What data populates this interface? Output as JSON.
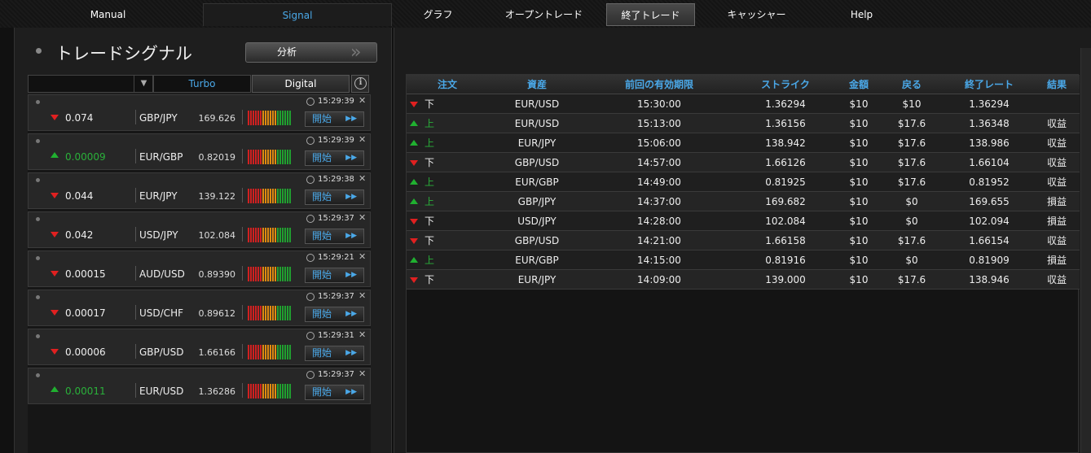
{
  "nav": {
    "tabs": [
      {
        "label": "Manual"
      },
      {
        "label": "Signal"
      },
      {
        "label": "グラフ"
      },
      {
        "label": "オープントレード"
      },
      {
        "label": "終了トレード"
      },
      {
        "label": "キャッシャー"
      },
      {
        "label": "Help"
      }
    ],
    "active_tab": "終了トレード"
  },
  "signal_panel": {
    "title": "トレードシグナル",
    "analyze_button": "分析",
    "filter": {
      "selected": "",
      "turbo_label": "Turbo",
      "digital_label": "Digital"
    },
    "start_label": "開始",
    "signals": [
      {
        "direction": "down",
        "value": "0.074",
        "pair": "GBP/JPY",
        "price": "169.626",
        "time": "15:29:39"
      },
      {
        "direction": "up",
        "value": "0.00009",
        "pair": "EUR/GBP",
        "price": "0.82019",
        "time": "15:29:39"
      },
      {
        "direction": "down",
        "value": "0.044",
        "pair": "EUR/JPY",
        "price": "139.122",
        "time": "15:29:38"
      },
      {
        "direction": "down",
        "value": "0.042",
        "pair": "USD/JPY",
        "price": "102.084",
        "time": "15:29:37"
      },
      {
        "direction": "down",
        "value": "0.00015",
        "pair": "AUD/USD",
        "price": "0.89390",
        "time": "15:29:21"
      },
      {
        "direction": "down",
        "value": "0.00017",
        "pair": "USD/CHF",
        "price": "0.89612",
        "time": "15:29:37"
      },
      {
        "direction": "down",
        "value": "0.00006",
        "pair": "GBP/USD",
        "price": "1.66166",
        "time": "15:29:31"
      },
      {
        "direction": "up",
        "value": "0.00011",
        "pair": "EUR/USD",
        "price": "1.36286",
        "time": "15:29:37"
      }
    ]
  },
  "closed_trades": {
    "columns": [
      "注文",
      "資産",
      "前回の有効期限",
      "ストライク",
      "金額",
      "戻る",
      "終了レート",
      "結果"
    ],
    "rows": [
      {
        "direction": "down",
        "order": "下",
        "asset": "EUR/USD",
        "expiry": "15:30:00",
        "strike": "1.36294",
        "amount": "$10",
        "return": "$10",
        "close_rate": "1.36294",
        "result": ""
      },
      {
        "direction": "up",
        "order": "上",
        "asset": "EUR/USD",
        "expiry": "15:13:00",
        "strike": "1.36156",
        "amount": "$10",
        "return": "$17.6",
        "close_rate": "1.36348",
        "result": "収益"
      },
      {
        "direction": "up",
        "order": "上",
        "asset": "EUR/JPY",
        "expiry": "15:06:00",
        "strike": "138.942",
        "amount": "$10",
        "return": "$17.6",
        "close_rate": "138.986",
        "result": "収益"
      },
      {
        "direction": "down",
        "order": "下",
        "asset": "GBP/USD",
        "expiry": "14:57:00",
        "strike": "1.66126",
        "amount": "$10",
        "return": "$17.6",
        "close_rate": "1.66104",
        "result": "収益"
      },
      {
        "direction": "up",
        "order": "上",
        "asset": "EUR/GBP",
        "expiry": "14:49:00",
        "strike": "0.81925",
        "amount": "$10",
        "return": "$17.6",
        "close_rate": "0.81952",
        "result": "収益"
      },
      {
        "direction": "up",
        "order": "上",
        "asset": "GBP/JPY",
        "expiry": "14:37:00",
        "strike": "169.682",
        "amount": "$10",
        "return": "$0",
        "close_rate": "169.655",
        "result": "損益"
      },
      {
        "direction": "down",
        "order": "下",
        "asset": "USD/JPY",
        "expiry": "14:28:00",
        "strike": "102.084",
        "amount": "$10",
        "return": "$0",
        "close_rate": "102.094",
        "result": "損益"
      },
      {
        "direction": "down",
        "order": "下",
        "asset": "GBP/USD",
        "expiry": "14:21:00",
        "strike": "1.66158",
        "amount": "$10",
        "return": "$17.6",
        "close_rate": "1.66154",
        "result": "収益"
      },
      {
        "direction": "up",
        "order": "上",
        "asset": "EUR/GBP",
        "expiry": "14:15:00",
        "strike": "0.81916",
        "amount": "$10",
        "return": "$0",
        "close_rate": "0.81909",
        "result": "損益"
      },
      {
        "direction": "down",
        "order": "下",
        "asset": "EUR/JPY",
        "expiry": "14:09:00",
        "strike": "139.000",
        "amount": "$10",
        "return": "$17.6",
        "close_rate": "138.946",
        "result": "収益"
      }
    ]
  },
  "colors": {
    "accent": "#4aa8e8",
    "up": "#2ab03a",
    "down": "#e02020"
  }
}
